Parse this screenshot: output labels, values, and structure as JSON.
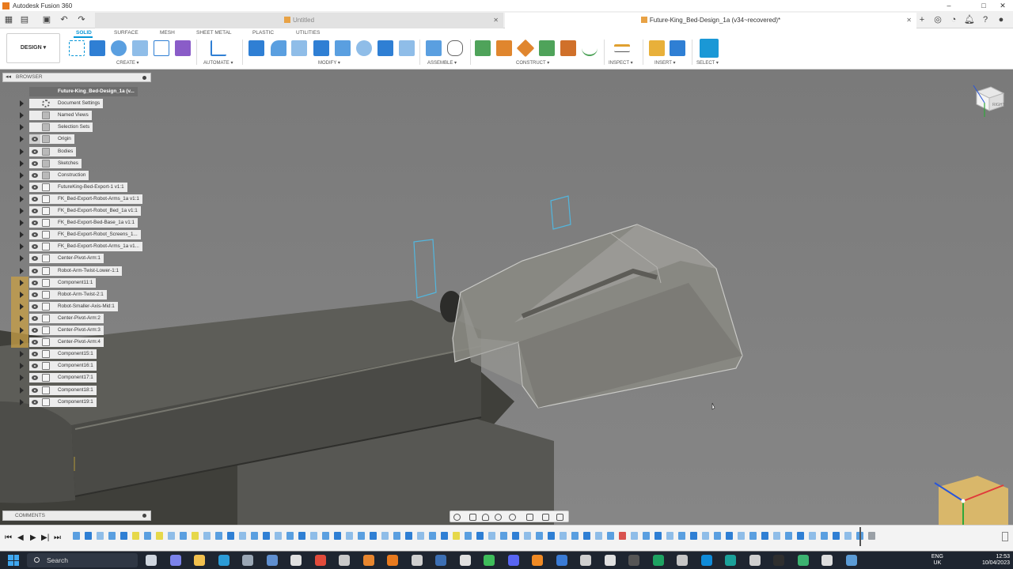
{
  "window": {
    "title": "Autodesk Fusion 360",
    "controls": [
      "–",
      "□",
      "✕"
    ]
  },
  "tabs": [
    {
      "label": "Untitled",
      "active": false
    },
    {
      "label": "Future-King_Bed-Design_1a (v34~recovered)*",
      "active": true
    }
  ],
  "ribbon": {
    "workspace": "DESIGN ▾",
    "tabs": [
      "SOLID",
      "SURFACE",
      "MESH",
      "SHEET METAL",
      "PLASTIC",
      "UTILITIES"
    ],
    "active_tab": "SOLID",
    "groups": [
      "CREATE ▾",
      "AUTOMATE ▾",
      "MODIFY ▾",
      "ASSEMBLE ▾",
      "CONSTRUCT ▾",
      "INSPECT ▾",
      "INSERT ▾",
      "SELECT ▾"
    ]
  },
  "browser": {
    "title": "BROWSER",
    "root": "Future-King_Bed-Design_1a (v...",
    "items": [
      {
        "label": "Document Settings",
        "icon": "gear-icon",
        "eye": false
      },
      {
        "label": "Named Views",
        "icon": "folder-icon",
        "eye": false
      },
      {
        "label": "Selection Sets",
        "icon": "folder-icon",
        "eye": false
      },
      {
        "label": "Origin",
        "icon": "folder-icon",
        "eye": true,
        "hidden": true
      },
      {
        "label": "Bodies",
        "icon": "folder-icon",
        "eye": true
      },
      {
        "label": "Sketches",
        "icon": "folder-icon",
        "eye": true
      },
      {
        "label": "Construction",
        "icon": "folder-icon",
        "eye": true
      },
      {
        "label": "FutureKing-Bed-Export-1 v1:1",
        "icon": "component-icon",
        "eye": true
      },
      {
        "label": "FK_Bed-Export-Robot-Arms_1a v1:1",
        "icon": "component-icon",
        "eye": true
      },
      {
        "label": "FK_Bed-Export-Robot_Bed_1a v1:1",
        "icon": "component-icon",
        "eye": true
      },
      {
        "label": "FK_Bed-Export-Bed-Base_1a v1:1",
        "icon": "component-icon",
        "eye": true
      },
      {
        "label": "FK_Bed-Export-Robot_Screens_1...",
        "icon": "component-icon",
        "eye": true
      },
      {
        "label": "FK_Bed-Export-Robot-Arms_1a v1...",
        "icon": "component-icon",
        "eye": true
      },
      {
        "label": "Center-Pivot-Arm:1",
        "icon": "component-icon",
        "eye": true
      },
      {
        "label": "Robot-Arm-Twist-Lower-1:1",
        "icon": "component-icon",
        "eye": true
      },
      {
        "label": "Component11:1",
        "icon": "component-icon",
        "eye": true
      },
      {
        "label": "Robot-Arm-Twist-2:1",
        "icon": "component-icon",
        "eye": true
      },
      {
        "label": "Robot-Smaller-Axis-Mid:1",
        "icon": "component-icon",
        "eye": true
      },
      {
        "label": "Center-Pivot-Arm:2",
        "icon": "component-icon",
        "eye": true
      },
      {
        "label": "Center-Pivot-Arm:3",
        "icon": "component-icon",
        "eye": true
      },
      {
        "label": "Center-Pivot-Arm:4",
        "icon": "component-icon",
        "eye": true
      },
      {
        "label": "Component15:1",
        "icon": "component-icon",
        "eye": true
      },
      {
        "label": "Component16:1",
        "icon": "component-icon",
        "eye": true
      },
      {
        "label": "Component17:1",
        "icon": "component-icon",
        "eye": true
      },
      {
        "label": "Component18:1",
        "icon": "component-icon",
        "eye": true
      },
      {
        "label": "Component19:1",
        "icon": "component-icon",
        "eye": true
      }
    ]
  },
  "viewcube": {
    "face": "RIGHT"
  },
  "comments": {
    "title": "COMMENTS"
  },
  "timeline": {
    "controls": [
      "⏮",
      "◀",
      "▶",
      "▶|",
      "⏭"
    ]
  },
  "taskbar": {
    "search_placeholder": "Search",
    "language": "ENG",
    "region": "UK",
    "time": "12:53",
    "date": "10/04/2023"
  },
  "colors": {
    "accent": "#0696d7",
    "viewport_bg": "#7d7d7d",
    "highlight": "#c9a046",
    "taskbar": "#1e2530"
  }
}
